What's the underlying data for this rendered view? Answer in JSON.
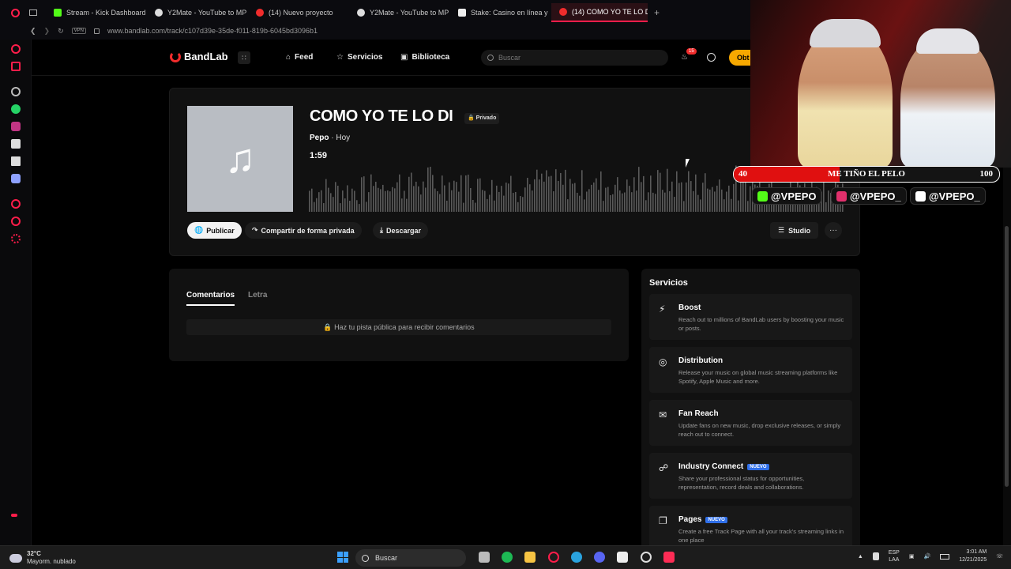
{
  "browser": {
    "tabs": [
      {
        "label": "Stream - Kick Dashboard",
        "color": "#53fc18"
      },
      {
        "label": "Y2Mate - YouTube to MP",
        "color": "#dddddd"
      },
      {
        "label": "(14) Nuevo proyecto",
        "color": "#f12c2c"
      },
      {
        "label": "Y2Mate - YouTube to MP",
        "color": "#dddddd"
      },
      {
        "label": "Stake: Casino en línea y",
        "color": "#eeeeee"
      },
      {
        "label": "(14) COMO YO TE LO DI",
        "color": "#f12c2c",
        "active": true
      }
    ],
    "url": "www.bandlab.com/track/c107d39e-35de-f011-819b-6045bd3096b1",
    "vpn": "VPN"
  },
  "header": {
    "logo": "BandLab",
    "nav": [
      "Feed",
      "Servicios",
      "Biblioteca"
    ],
    "search_placeholder": "Buscar",
    "notification_count": "15",
    "cta_label": "Obt"
  },
  "track": {
    "title": "COMO YO TE LO DI",
    "privacy": "Privado",
    "artist": "Pepo",
    "time": "· Hoy",
    "duration": "1:59",
    "actions": {
      "publish": "Publicar",
      "share": "Compartir de forma privada",
      "download": "Descargar",
      "studio": "Studio",
      "more": "···"
    }
  },
  "comments": {
    "tabs": [
      "Comentarios",
      "Letra"
    ],
    "notice": "Haz tu pista pública para recibir comentarios"
  },
  "services": {
    "title": "Servicios",
    "items": [
      {
        "title": "Boost",
        "icon": "bolt-icon",
        "glyph": "⚡",
        "badge": "",
        "desc": "Reach out to millions of BandLab users by boosting your music or posts."
      },
      {
        "title": "Distribution",
        "icon": "distribution-icon",
        "glyph": "◎",
        "badge": "",
        "desc": "Release your music on global music streaming platforms like Spotify, Apple Music and more."
      },
      {
        "title": "Fan Reach",
        "icon": "mail-icon",
        "glyph": "✉",
        "badge": "",
        "desc": "Update fans on new music, drop exclusive releases, or simply reach out to connect."
      },
      {
        "title": "Industry Connect",
        "icon": "people-icon",
        "glyph": "☍",
        "badge": "NUEVO",
        "desc": "Share your professional status for opportunities, representation, record deals and collaborations."
      },
      {
        "title": "Pages",
        "icon": "pages-icon",
        "glyph": "❐",
        "badge": "NUEVO",
        "desc": "Create a free Track Page with all your track's streaming links in one place"
      }
    ]
  },
  "overlay": {
    "left": "40",
    "label": "ME TIÑO EL PELO",
    "right": "100",
    "progress": 0.4,
    "socials": [
      {
        "handle": "@VPEPO",
        "color": "#53fc18"
      },
      {
        "handle": "@VPEPO_",
        "color": "#e1306c"
      },
      {
        "handle": "@VPEPO_",
        "color": "#ffffff"
      }
    ]
  },
  "taskbar": {
    "temp": "32°C",
    "weather": "Mayorm. nublado",
    "search": "Buscar",
    "lang": "ESP",
    "lang2": "LAA",
    "time": "3:01 AM",
    "date": "12/21/2025"
  }
}
